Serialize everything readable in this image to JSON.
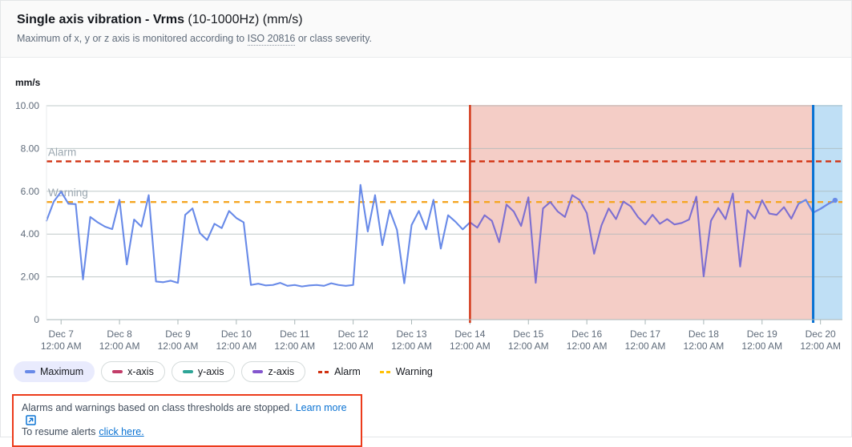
{
  "header": {
    "title_strong": "Single axis vibration - Vrms",
    "title_rest": " (10-1000Hz) (mm/s)",
    "subtitle_pre": "Maximum of x, y or z axis is monitored according to ",
    "subtitle_term": "ISO 20816",
    "subtitle_post": " or class severity."
  },
  "axis": {
    "y_unit": "mm/s"
  },
  "alert": {
    "line1_text": "Alarms and warnings based on class thresholds are stopped.",
    "line1_link": "Learn more",
    "external_icon": "external-link-icon",
    "line2_text": "To resume alerts",
    "line2_link": "click here."
  },
  "legend": [
    {
      "label": "Maximum",
      "color": "#688ae8",
      "style": "solid",
      "selected": true
    },
    {
      "label": "x-axis",
      "color": "#c33d69",
      "style": "solid",
      "selected": false
    },
    {
      "label": "y-axis",
      "color": "#2ea597",
      "style": "solid",
      "selected": false
    },
    {
      "label": "z-axis",
      "color": "#8456ce",
      "style": "solid",
      "selected": false
    },
    {
      "label": "Alarm",
      "color": "#d13212",
      "style": "dashed",
      "selected": false
    },
    {
      "label": "Warning",
      "color": "#ffc107",
      "style": "dashed",
      "selected": false
    }
  ],
  "chart_data": {
    "type": "line",
    "title": "Single axis vibration - Vrms (10-1000Hz) (mm/s)",
    "xlabel": "",
    "ylabel": "mm/s",
    "ylim": [
      0,
      10
    ],
    "yticks": [
      0,
      2,
      4,
      6,
      8,
      10
    ],
    "ytick_labels": [
      "0",
      "2.00",
      "4.00",
      "6.00",
      "8.00",
      "10.00"
    ],
    "grid": true,
    "legend_position": "bottom-left",
    "xtick_labels": [
      "Dec 7\n12:00 AM",
      "Dec 8\n12:00 AM",
      "Dec 9\n12:00 AM",
      "Dec 10\n12:00 AM",
      "Dec 11\n12:00 AM",
      "Dec 12\n12:00 AM",
      "Dec 13\n12:00 AM",
      "Dec 14\n12:00 AM",
      "Dec 15\n12:00 AM",
      "Dec 16\n12:00 AM",
      "Dec 17\n12:00 AM",
      "Dec 18\n12:00 AM",
      "Dec 19\n12:00 AM",
      "Dec 20\n12:00 AM"
    ],
    "xticks_days": [
      "Dec 7",
      "Dec 8",
      "Dec 9",
      "Dec 10",
      "Dec 11",
      "Dec 12",
      "Dec 13",
      "Dec 14",
      "Dec 15",
      "Dec 16",
      "Dec 17",
      "Dec 18",
      "Dec 19",
      "Dec 20"
    ],
    "xticks_times": [
      "12:00 AM",
      "12:00 AM",
      "12:00 AM",
      "12:00 AM",
      "12:00 AM",
      "12:00 AM",
      "12:00 AM",
      "12:00 AM",
      "12:00 AM",
      "12:00 AM",
      "12:00 AM",
      "12:00 AM",
      "12:00 AM",
      "12:00 AM"
    ],
    "threshold_lines": [
      {
        "name": "Alarm",
        "value": 7.4,
        "color": "#d13212",
        "style": "dashed",
        "label": "Alarm"
      },
      {
        "name": "Warning",
        "value": 5.5,
        "color": "#f5a623",
        "style": "dashed",
        "label": "Warning"
      }
    ],
    "annotations": [
      {
        "type": "vline",
        "name": "alarms-stopped-marker",
        "x_index": 58,
        "color": "#d13212"
      },
      {
        "type": "vline",
        "name": "now-marker",
        "x_index": 105,
        "color": "#0972d3"
      },
      {
        "type": "region",
        "name": "alarms-stopped-region",
        "from_index": 58,
        "to_index": 105,
        "color": "#f4cdc6"
      },
      {
        "type": "region",
        "name": "future-region",
        "from_index": 105,
        "to_index": 109,
        "color": "#bfdff5"
      }
    ],
    "series": [
      {
        "name": "Maximum",
        "color_primary": "#688ae8",
        "color_secondary": "#7d6fd1",
        "secondary_from_index": 58,
        "values": [
          4.62,
          5.52,
          5.98,
          5.42,
          5.4,
          1.88,
          4.8,
          4.55,
          4.35,
          4.23,
          5.6,
          2.58,
          4.68,
          4.35,
          5.82,
          1.78,
          1.75,
          1.82,
          1.72,
          4.9,
          5.2,
          4.05,
          3.72,
          4.48,
          4.28,
          5.08,
          4.75,
          4.55,
          1.62,
          1.68,
          1.6,
          1.62,
          1.72,
          1.58,
          1.62,
          1.55,
          1.6,
          1.62,
          1.58,
          1.7,
          1.62,
          1.58,
          1.62,
          6.3,
          4.12,
          5.82,
          3.48,
          5.12,
          4.2,
          1.7,
          4.42,
          5.08,
          4.22,
          5.6,
          3.32,
          4.88,
          4.58,
          4.22,
          4.55,
          4.3,
          4.88,
          4.62,
          3.62,
          5.38,
          5.05,
          4.38,
          5.72,
          1.72,
          5.2,
          5.5,
          5.06,
          4.8,
          5.82,
          5.6,
          4.98,
          3.08,
          4.4,
          5.2,
          4.7,
          5.52,
          5.3,
          4.8,
          4.45,
          4.9,
          4.48,
          4.7,
          4.45,
          4.52,
          4.68,
          5.75,
          2.02,
          4.62,
          5.22,
          4.7,
          5.9,
          2.48,
          5.12,
          4.72,
          5.58,
          4.96,
          4.9,
          5.26,
          4.72,
          5.42,
          5.6,
          5.0,
          5.18,
          5.4,
          5.58
        ]
      }
    ]
  }
}
